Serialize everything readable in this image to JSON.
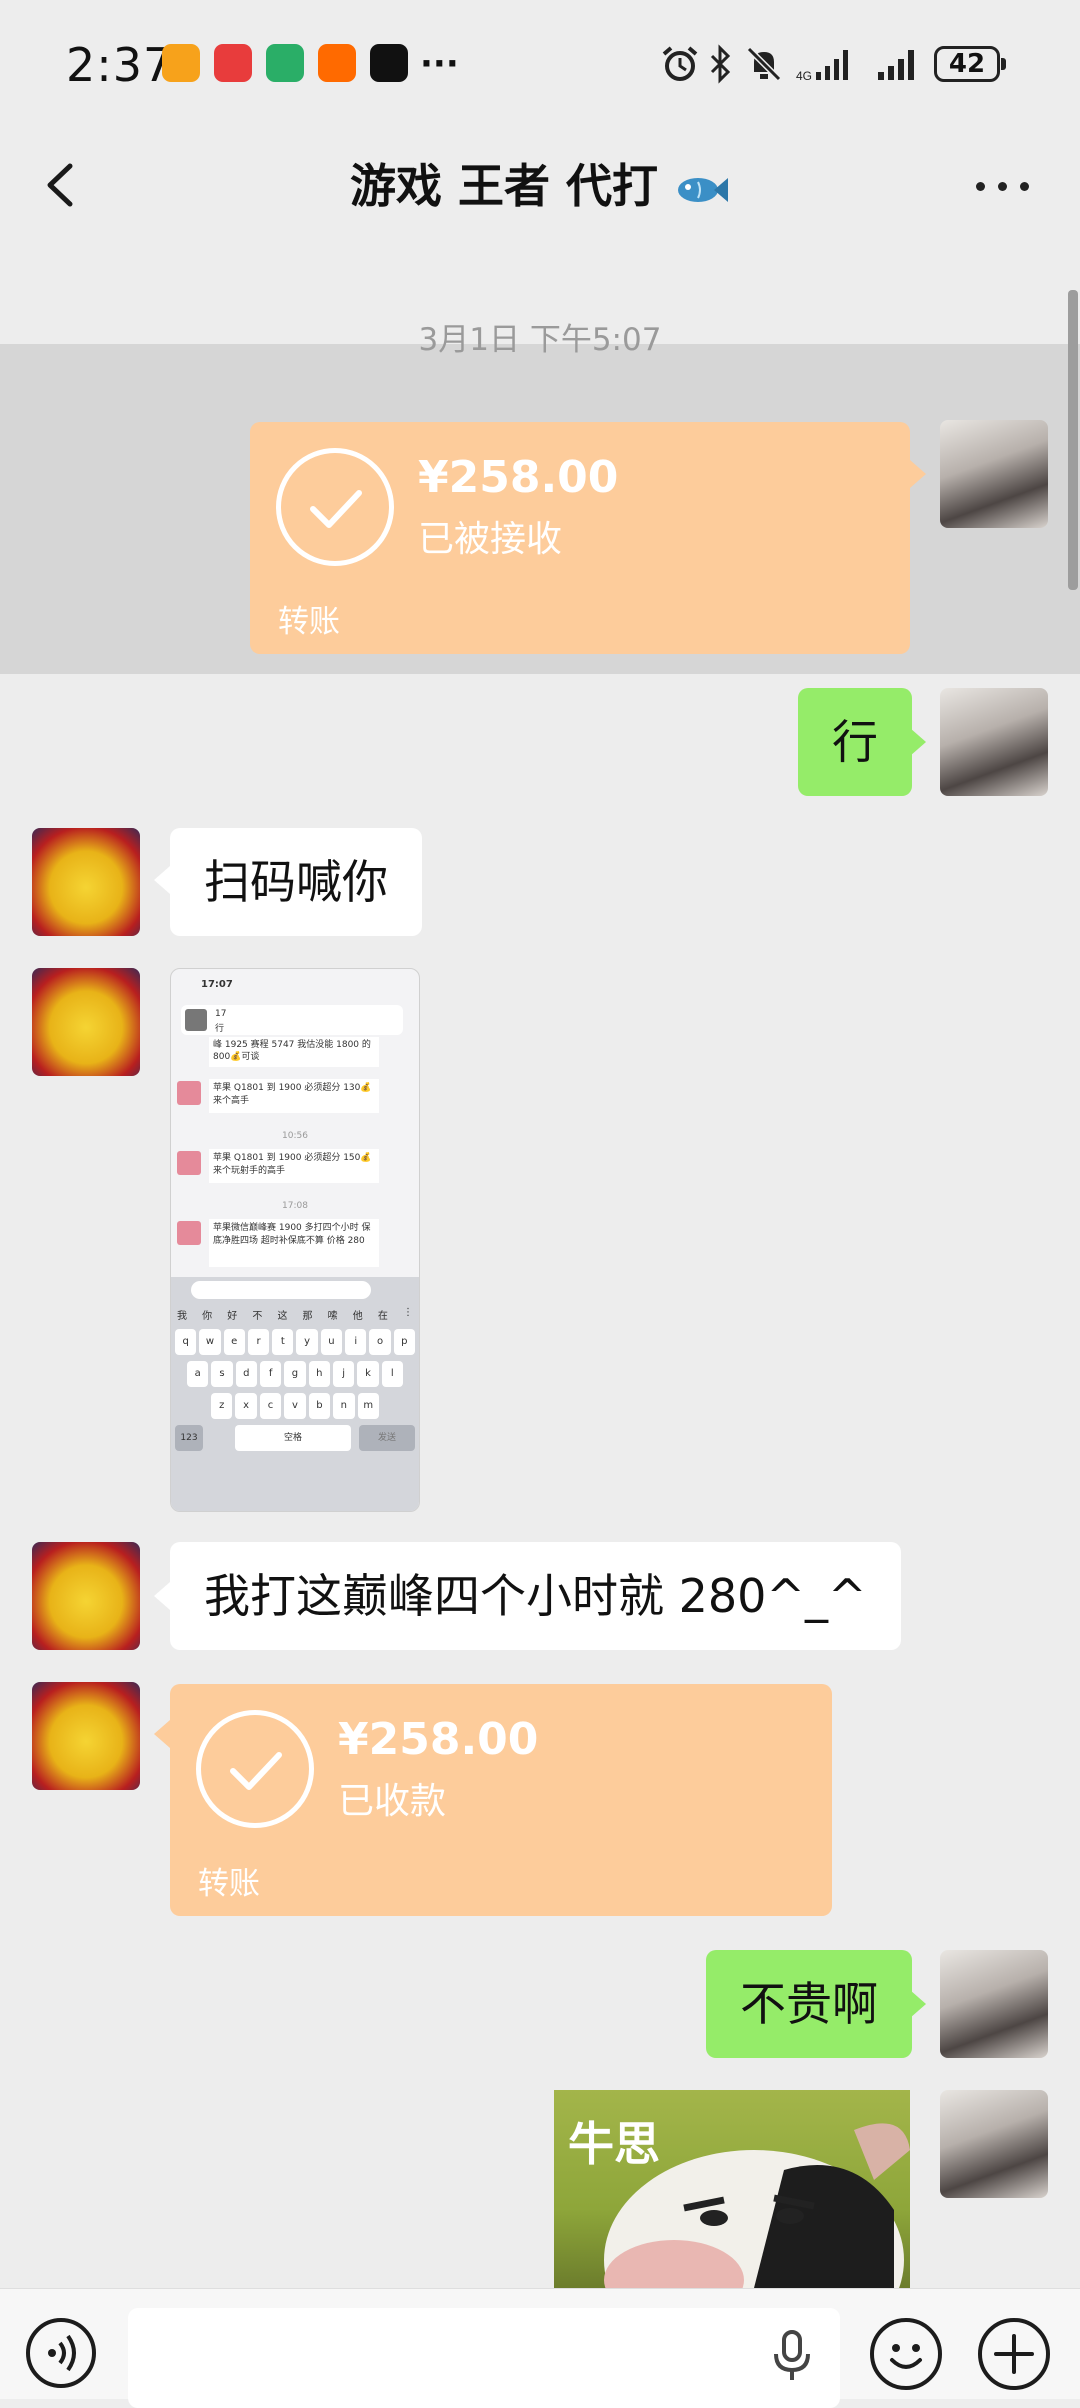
{
  "status_bar": {
    "time": "2:37",
    "more": "···",
    "battery": "42",
    "app_icons": [
      "taobao-live-icon",
      "pinduoduo-icon",
      "wechat-icon",
      "taobao-icon",
      "tiktok-icon"
    ],
    "status_icons": [
      "alarm-icon",
      "bluetooth-icon",
      "mute-icon",
      "signal-icon",
      "signal-icon"
    ]
  },
  "header": {
    "title": "游戏 王者 代打",
    "back_icon": "chevron-left-icon",
    "more_icon": "more-dots-icon",
    "title_icon": "fish-icon"
  },
  "chat": {
    "timestamp": "3月1日 下午5:07",
    "messages": [
      {
        "side": "right",
        "type": "transfer",
        "amount": "¥258.00",
        "status": "已被接收",
        "label": "转账"
      },
      {
        "side": "right",
        "type": "text",
        "text": "行"
      },
      {
        "side": "left",
        "type": "text",
        "text": "扫码喊你"
      },
      {
        "side": "left",
        "type": "image",
        "image": "screenshot-image"
      },
      {
        "side": "left",
        "type": "text",
        "text": "我打这巅峰四个小时就 280^_^"
      },
      {
        "side": "left",
        "type": "transfer",
        "amount": "¥258.00",
        "status": "已收款",
        "label": "转账"
      },
      {
        "side": "right",
        "type": "text",
        "text": "不贵啊"
      },
      {
        "side": "right",
        "type": "sticker",
        "caption": "牛思"
      }
    ],
    "screenshot": {
      "time": "17:07",
      "top_item": "17",
      "top_sub": "行",
      "lines": [
        "峰 1925 赛程 5747 我估没能 1800 的 800💰可谈",
        "苹果 Q1801 到 1900 必须超分 130💰 来个高手",
        "10:56",
        "苹果 Q1801 到 1900 必须超分 150💰 来个玩射手的高手",
        "17:08",
        "苹果微信巅峰赛 1900 多打四个小时 保底净胜四场 超时补保底不算 价格 280"
      ],
      "candidates": [
        "我",
        "你",
        "好",
        "不",
        "这",
        "那",
        "嗦",
        "他",
        "在",
        "⋮"
      ],
      "row1": [
        "q",
        "w",
        "e",
        "r",
        "t",
        "y",
        "u",
        "i",
        "o",
        "p"
      ],
      "row2": [
        "a",
        "s",
        "d",
        "f",
        "g",
        "h",
        "j",
        "k",
        "l"
      ],
      "row3": [
        "z",
        "x",
        "c",
        "v",
        "b",
        "n",
        "m"
      ],
      "num_key": "123",
      "space_key": "空格",
      "send_key": "发送"
    }
  },
  "input_bar": {
    "placeholder": "",
    "voice_icon": "voice-icon",
    "mic_icon": "microphone-icon",
    "emoji_icon": "emoji-icon",
    "plus_icon": "plus-icon"
  }
}
